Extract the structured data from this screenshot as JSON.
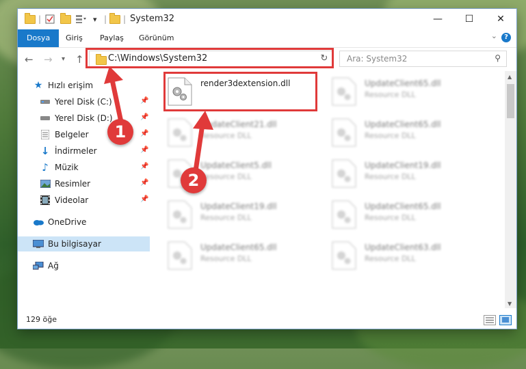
{
  "window": {
    "title": "System32",
    "controls": {
      "minimize": "—",
      "maximize": "☐",
      "close": "✕"
    }
  },
  "ribbon": {
    "tabs": [
      "Dosya",
      "Giriş",
      "Paylaş",
      "Görünüm"
    ],
    "help": "?"
  },
  "address": {
    "path": "C:\\Windows\\System32",
    "search_placeholder": "Ara: System32"
  },
  "sidebar": {
    "quick_access": "Hızlı erişim",
    "items": [
      {
        "label": "Yerel Disk (C:)",
        "icon": "drive-icon"
      },
      {
        "label": "Yerel Disk (D:)",
        "icon": "drive-icon"
      },
      {
        "label": "Belgeler",
        "icon": "documents-icon"
      },
      {
        "label": "İndirmeler",
        "icon": "download-icon"
      },
      {
        "label": "Müzik",
        "icon": "music-icon"
      },
      {
        "label": "Resimler",
        "icon": "pictures-icon"
      },
      {
        "label": "Videolar",
        "icon": "videos-icon"
      }
    ],
    "onedrive": "OneDrive",
    "this_pc": "Bu bilgisayar",
    "network": "Ağ"
  },
  "files": {
    "highlighted": {
      "name": "render3dextension.dll"
    },
    "others": [
      {
        "name": "UpdateClient65.dll",
        "type": "Resource DLL"
      },
      {
        "name": "UpdateClient21.dll",
        "type": "Resource DLL"
      },
      {
        "name": "UpdateClient65.dll",
        "type": "Resource DLL"
      },
      {
        "name": "UpdateClient5.dll",
        "type": "Resource DLL"
      },
      {
        "name": "UpdateClient19.dll",
        "type": "Resource DLL"
      },
      {
        "name": "UpdateClient19.dll",
        "type": "Resource DLL"
      },
      {
        "name": "UpdateClient65.dll",
        "type": "Resource DLL"
      },
      {
        "name": "UpdateClient65.dll",
        "type": "Resource DLL"
      },
      {
        "name": "UpdateClient63.dll",
        "type": "Resource DLL"
      }
    ]
  },
  "status": {
    "count": "129 öğe"
  },
  "annotations": {
    "step1": "1",
    "step2": "2"
  },
  "colors": {
    "accent": "#1979ca",
    "annotation": "#e03a3a",
    "selected": "#cce4f7"
  }
}
